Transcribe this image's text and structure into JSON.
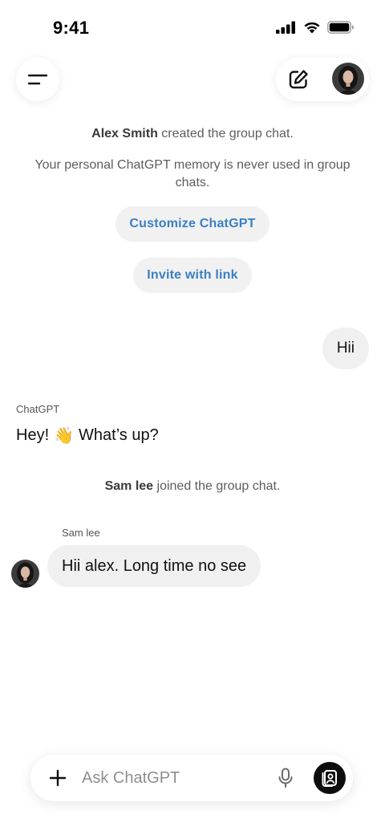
{
  "status_bar": {
    "time": "9:41"
  },
  "header": {
    "menu_icon": "sidebar-menu-icon",
    "compose_icon": "new-chat-pencil-icon",
    "avatar_icon": "user-avatar"
  },
  "system": {
    "created_name": "Alex Smith",
    "created_text": " created the group chat.",
    "memory_note": "Your personal ChatGPT memory is never used in group chats.",
    "joined_name": "Sam lee",
    "joined_text": " joined the group chat."
  },
  "actions": {
    "customize_label": "Customize ChatGPT",
    "invite_label": "Invite with link"
  },
  "messages": {
    "user_message": "Hii",
    "assistant_sender": "ChatGPT",
    "assistant_message_start": "Hey!",
    "assistant_emoji": "👋",
    "assistant_message_end": "What’s up?",
    "other_sender": "Sam lee",
    "other_message": "Hii alex. Long time no see"
  },
  "composer": {
    "placeholder": "Ask ChatGPT"
  },
  "colors": {
    "link_blue": "#3a7fc4",
    "bubble_gray": "#f0f0f0",
    "voice_button": "#0d0d0d"
  }
}
